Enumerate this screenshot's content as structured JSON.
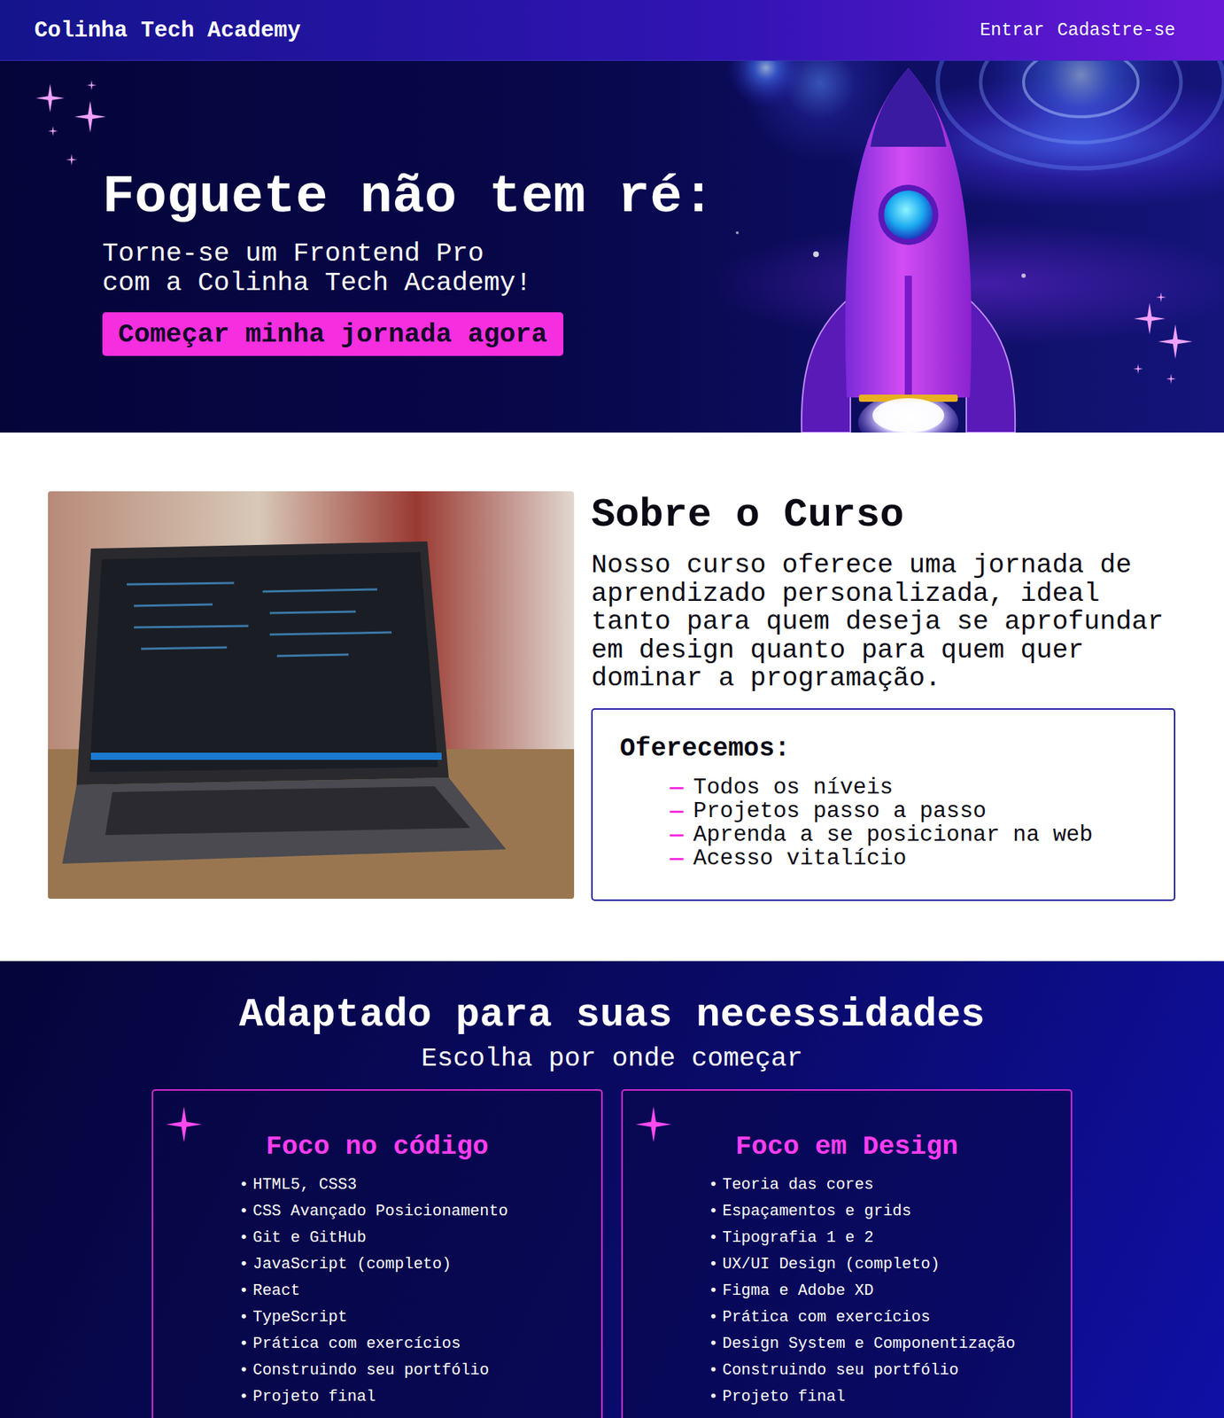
{
  "header": {
    "logo": "Colinha Tech Academy",
    "nav": [
      "Entrar",
      "Cadastre-se"
    ]
  },
  "hero": {
    "title": "Foguete não tem ré:",
    "subtitle": [
      "Torne-se um Frontend Pro",
      "com a Colinha Tech Academy!"
    ],
    "cta": "Começar minha jornada agora"
  },
  "about": {
    "title": "Sobre o Curso",
    "text": "Nosso curso oferece uma jornada de aprendizado personalizada, ideal tanto para quem deseja se aprofundar em design quanto para quem quer dominar a programação.",
    "offers": {
      "title": "Oferecemos:",
      "marker": "—",
      "items": [
        "Todos os níveis",
        "Projetos passo a passo",
        "Aprenda a se posicionar na web",
        "Acesso vitalício"
      ]
    }
  },
  "tracks": {
    "title": "Adaptado para suas necessidades",
    "subtitle": "Escolha por onde começar",
    "bullet": "•",
    "cards": [
      {
        "title": "Foco no código",
        "items": [
          "HTML5, CSS3",
          "CSS Avançado Posicionamento",
          "Git e GitHub",
          "JavaScript (completo)",
          "React",
          "TypeScript",
          "Prática com exercícios",
          "Construindo seu portfólio",
          "Projeto final"
        ]
      },
      {
        "title": "Foco em Design",
        "items": [
          "Teoria das cores",
          "Espaçamentos e grids",
          "Tipografia 1 e 2",
          "UX/UI Design (completo)",
          "Figma e Adobe XD",
          "Prática com exercícios",
          "Design System e Componentização",
          "Construindo seu portfólio",
          "Projeto final"
        ]
      }
    ]
  }
}
